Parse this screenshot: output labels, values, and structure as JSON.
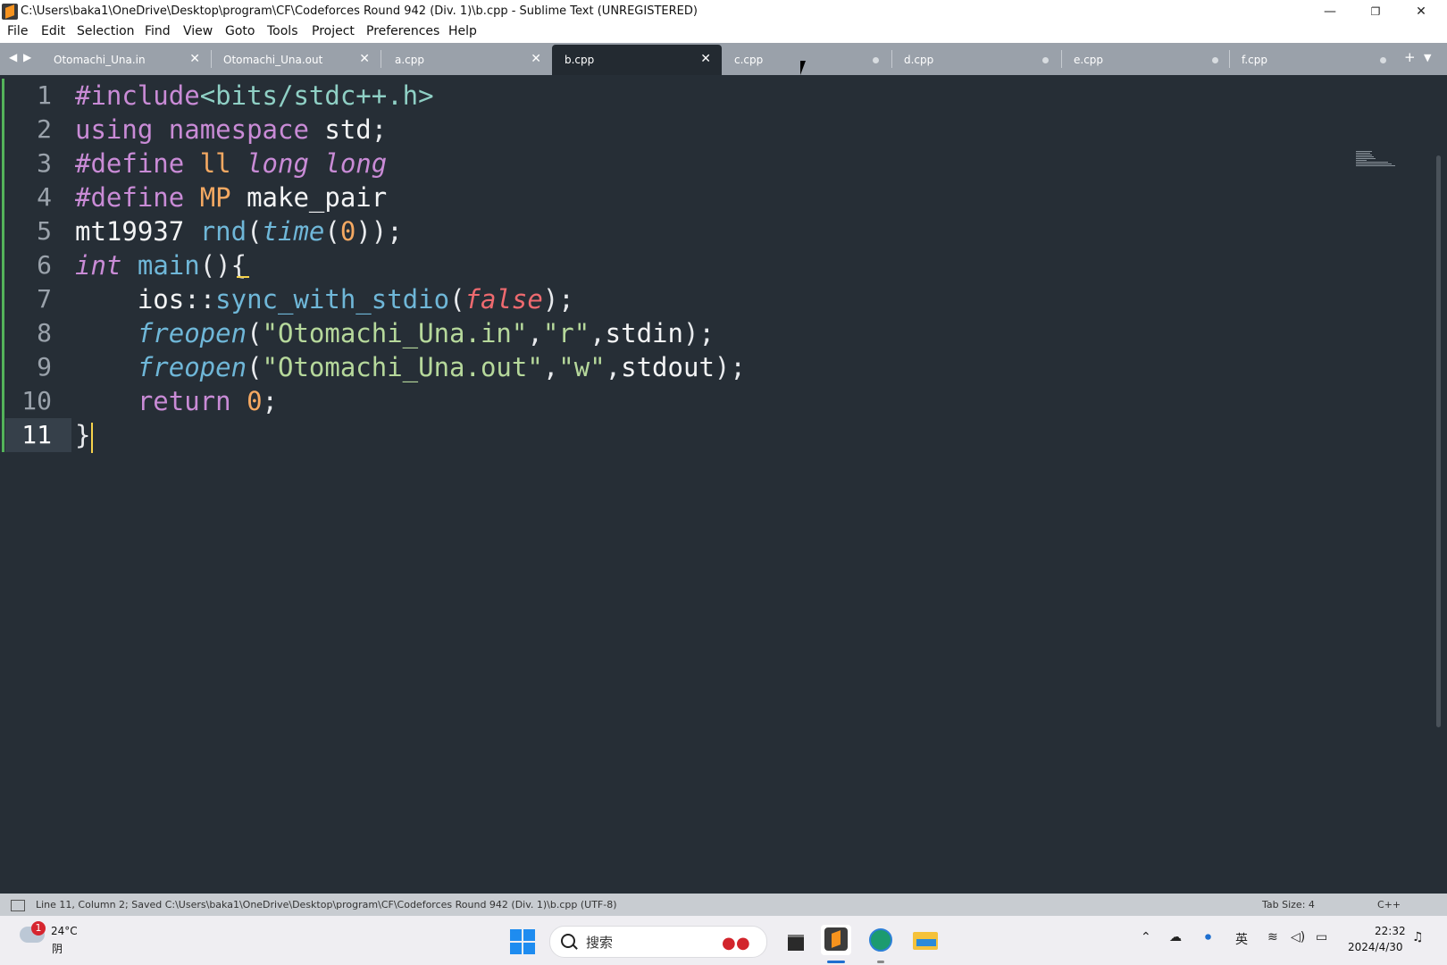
{
  "window": {
    "title": "C:\\Users\\baka1\\OneDrive\\Desktop\\program\\CF\\Codeforces Round 942 (Div. 1)\\b.cpp - Sublime Text (UNREGISTERED)",
    "minimize": "—",
    "restore": "❐",
    "close": "✕"
  },
  "menu": [
    "File",
    "Edit",
    "Selection",
    "Find",
    "View",
    "Goto",
    "Tools",
    "Project",
    "Preferences",
    "Help"
  ],
  "tabs": [
    {
      "label": "Otomachi_Una.in",
      "state": "close"
    },
    {
      "label": "Otomachi_Una.out",
      "state": "close"
    },
    {
      "label": "a.cpp",
      "state": "close"
    },
    {
      "label": "b.cpp",
      "state": "active"
    },
    {
      "label": "c.cpp",
      "state": "dirty"
    },
    {
      "label": "d.cpp",
      "state": "dirty"
    },
    {
      "label": "e.cpp",
      "state": "dirty"
    },
    {
      "label": "f.cpp",
      "state": "dirty"
    }
  ],
  "tab_nav": {
    "left": "◀",
    "right": "▶",
    "add": "+",
    "more": "▼",
    "close_glyph": "✕"
  },
  "code": {
    "line_numbers": [
      "1",
      "2",
      "3",
      "4",
      "5",
      "6",
      "7",
      "8",
      "9",
      "10",
      "11"
    ],
    "current_line": 11
  },
  "status": {
    "left": "Line 11, Column 2; Saved C:\\Users\\baka1\\OneDrive\\Desktop\\program\\CF\\Codeforces Round 942 (Div. 1)\\b.cpp (UTF-8)",
    "tab_size": "Tab Size: 4",
    "syntax": "C++"
  },
  "taskbar": {
    "weather_badge": "1",
    "temperature": "24°C",
    "weather": "阴",
    "search_placeholder": "搜索",
    "tray_ime": "英",
    "time": "22:32",
    "date": "2024/4/30"
  },
  "colors": {
    "editor_bg": "#262e36",
    "tab_bar": "#9aa1aa",
    "accent_green": "#54b35a",
    "caret": "#f6d34c"
  }
}
